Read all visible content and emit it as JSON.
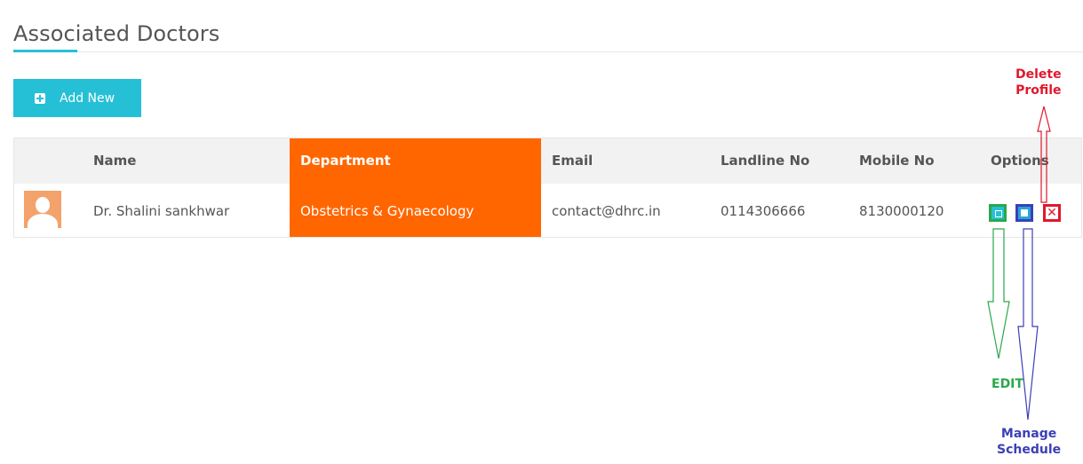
{
  "page": {
    "title": "Associated Doctors",
    "add_button_label": "Add New"
  },
  "table": {
    "columns": [
      "Name",
      "Department",
      "Email",
      "Landline No",
      "Mobile No",
      "Options"
    ],
    "rows": [
      {
        "name": "Dr. Shalini sankhwar",
        "department": "Obstetrics & Gynaecology",
        "email": "contact@dhrc.in",
        "landline": "0114306666",
        "mobile": "8130000120",
        "delete_glyph": "✕"
      }
    ]
  },
  "annotations": {
    "delete_line1": "Delete",
    "delete_line2": "Profile",
    "edit": "EDIT",
    "manage_line1": "Manage",
    "manage_line2": "Schedule"
  },
  "colors": {
    "accent": "#26c0d6",
    "department_highlight": "#ff6600",
    "edit_annotation": "#2aa84a",
    "manage_annotation": "#3c3fb5",
    "delete_annotation": "#e0182d"
  },
  "icons": [
    "plus-square-icon",
    "user-avatar-icon",
    "edit-icon",
    "calendar-icon",
    "close-icon"
  ]
}
